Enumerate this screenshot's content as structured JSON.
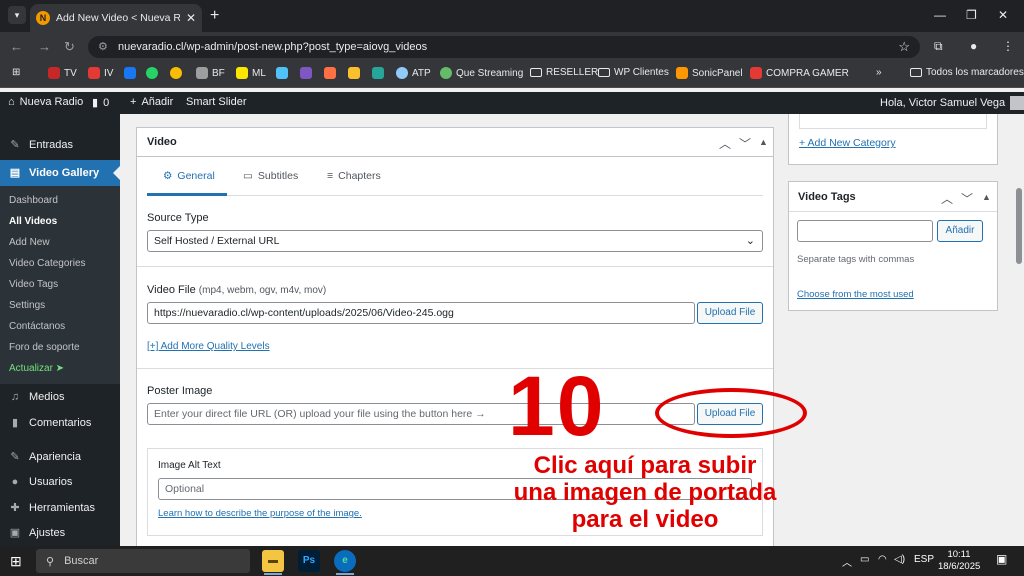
{
  "browser": {
    "tab_title": "Add New Video < Nueva Radio",
    "url": "nuevaradio.cl/wp-admin/post-new.php?post_type=aiovg_videos",
    "bookmarks": [
      "TV",
      "IV",
      "BF",
      "ML",
      "ATP",
      "Que Streaming",
      "RESELLER",
      "WP Clientes",
      "SonicPanel",
      "COMPRA GAMER"
    ],
    "all_bookmarks": "Todos los marcadores"
  },
  "adminbar": {
    "site_name": "Nueva Radio",
    "comments_count": "0",
    "add_new": "Añadir",
    "smart_slider": "Smart Slider",
    "greeting": "Hola, Victor Samuel Vega"
  },
  "sidebar": {
    "entradas": "Entradas",
    "video_gallery": "Video Gallery",
    "submenu": [
      "Dashboard",
      "All Videos",
      "Add New",
      "Video Categories",
      "Video Tags",
      "Settings",
      "Contáctanos",
      "Foro de soporte"
    ],
    "actualizar": "Actualizar ➤",
    "medios": "Medios",
    "comentarios": "Comentarios",
    "apariencia": "Apariencia",
    "usuarios": "Usuarios",
    "herramientas": "Herramientas",
    "ajustes": "Ajustes"
  },
  "video_box": {
    "title": "Video",
    "tabs": [
      "General",
      "Subtitles",
      "Chapters"
    ],
    "source_type_label": "Source Type",
    "source_type_value": "Self Hosted / External URL",
    "video_file_label": "Video File",
    "video_file_hint": "(mp4, webm, ogv, m4v, mov)",
    "video_file_value": "https://nuevaradio.cl/wp-content/uploads/2025/06/Video-245.ogg",
    "upload_file": "Upload File",
    "add_quality": "[+] Add More Quality Levels",
    "poster_label": "Poster Image",
    "poster_placeholder": "Enter your direct file URL (OR) upload your file using the button here →",
    "alt_label": "Image Alt Text",
    "alt_placeholder": "Optional",
    "alt_link": "Learn how to describe the purpose of the image."
  },
  "right": {
    "add_category": "+ Add New Category",
    "tags_title": "Video Tags",
    "tags_add": "Añadir",
    "tags_hint": "Separate tags with commas",
    "tags_most_used": "Choose from the most used"
  },
  "overlay": {
    "number": "10",
    "line1": "Clic aquí para subir",
    "line2": "una imagen de portada",
    "line3": "para el video"
  },
  "taskbar": {
    "search": "Buscar",
    "lang": "ESP",
    "time": "10:11",
    "date": "18/6/2025",
    "ps_label": "Ps"
  },
  "colors": {
    "wp_blue": "#2271b1",
    "admin_dark": "#1d2327",
    "annotation_red": "#e00000"
  }
}
